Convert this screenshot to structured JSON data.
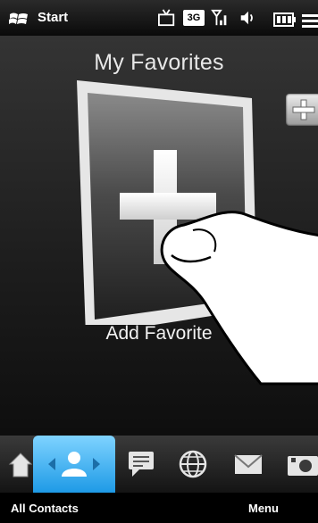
{
  "statusbar": {
    "start_label": "Start",
    "icons": [
      "start-logo-icon",
      "tv-icon",
      "3g-icon",
      "signal-icon",
      "volume-icon",
      "battery-icon",
      "menu-lines-icon"
    ],
    "network_badge": "3G"
  },
  "main": {
    "title": "My Favorites",
    "card_label": "Add Favorite"
  },
  "dock": {
    "items": [
      "home-icon",
      "all-contacts-icon",
      "messaging-icon",
      "internet-icon",
      "email-icon",
      "photos-icon"
    ],
    "selected": "all-contacts-icon",
    "accent_color": "#1e9ae6"
  },
  "softkeys": {
    "left": "All Contacts",
    "right": "Menu"
  }
}
